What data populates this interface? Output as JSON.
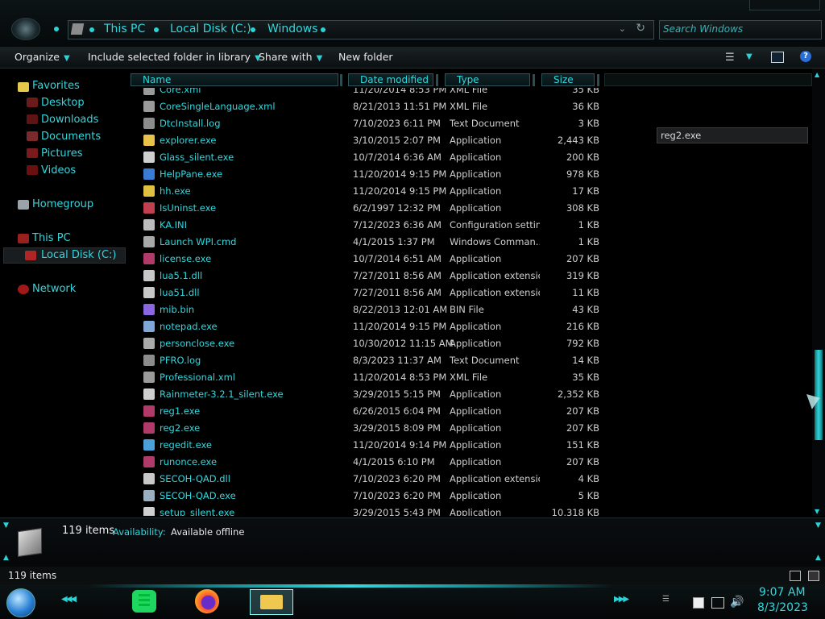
{
  "address": {
    "crumbs": [
      "This PC",
      "Local Disk (C:)",
      "Windows"
    ]
  },
  "search": {
    "placeholder": "Search Windows"
  },
  "toolbar": {
    "organize": "Organize",
    "include": "Include selected folder in library",
    "share": "Share with",
    "new_folder": "New folder",
    "help": "?"
  },
  "nav": {
    "favorites": "Favorites",
    "desktop": "Desktop",
    "downloads": "Downloads",
    "documents": "Documents",
    "pictures": "Pictures",
    "videos": "Videos",
    "homegroup": "Homegroup",
    "this_pc": "This PC",
    "local_disk": "Local Disk (C:)",
    "network": "Network"
  },
  "columns": {
    "name": "Name",
    "date": "Date modified",
    "type": "Type",
    "size": "Size"
  },
  "files": [
    {
      "name": "Core.xml",
      "date": "11/20/2014 8:53 PM",
      "type": "XML File",
      "size": "35 KB",
      "icon": "xml-icon"
    },
    {
      "name": "CoreSingleLanguage.xml",
      "date": "8/21/2013 11:51 PM",
      "type": "XML File",
      "size": "36 KB",
      "icon": "xml-icon"
    },
    {
      "name": "DtcInstall.log",
      "date": "7/10/2023 6:11 PM",
      "type": "Text Document",
      "size": "3 KB",
      "icon": "log-icon"
    },
    {
      "name": "explorer.exe",
      "date": "3/10/2015 2:07 PM",
      "type": "Application",
      "size": "2,443 KB",
      "icon": "folder-icon"
    },
    {
      "name": "Glass_silent.exe",
      "date": "10/7/2014 6:36 AM",
      "type": "Application",
      "size": "200 KB",
      "icon": "installer-icon"
    },
    {
      "name": "HelpPane.exe",
      "date": "11/20/2014 9:15 PM",
      "type": "Application",
      "size": "978 KB",
      "icon": "help-icon"
    },
    {
      "name": "hh.exe",
      "date": "11/20/2014 9:15 PM",
      "type": "Application",
      "size": "17 KB",
      "icon": "helpfile-icon"
    },
    {
      "name": "IsUninst.exe",
      "date": "6/2/1997 12:32 PM",
      "type": "Application",
      "size": "308 KB",
      "icon": "uninstall-icon"
    },
    {
      "name": "KA.INI",
      "date": "7/12/2023 6:36 AM",
      "type": "Configuration settin...",
      "size": "1 KB",
      "icon": "ini-icon"
    },
    {
      "name": "Launch WPI.cmd",
      "date": "4/1/2015 1:37 PM",
      "type": "Windows Comman...",
      "size": "1 KB",
      "icon": "cmd-icon"
    },
    {
      "name": "license.exe",
      "date": "10/7/2014 6:51 AM",
      "type": "Application",
      "size": "207 KB",
      "icon": "winrar-icon"
    },
    {
      "name": "lua5.1.dll",
      "date": "7/27/2011 8:56 AM",
      "type": "Application extension",
      "size": "319 KB",
      "icon": "dll-icon"
    },
    {
      "name": "lua51.dll",
      "date": "7/27/2011 8:56 AM",
      "type": "Application extension",
      "size": "11 KB",
      "icon": "dll-icon"
    },
    {
      "name": "mib.bin",
      "date": "8/22/2013 12:01 AM",
      "type": "BIN File",
      "size": "43 KB",
      "icon": "bin-icon"
    },
    {
      "name": "notepad.exe",
      "date": "11/20/2014 9:15 PM",
      "type": "Application",
      "size": "216 KB",
      "icon": "notepad-icon"
    },
    {
      "name": "personclose.exe",
      "date": "10/30/2012 11:15 AM",
      "type": "Application",
      "size": "792 KB",
      "icon": "arrow-up-icon"
    },
    {
      "name": "PFRO.log",
      "date": "8/3/2023 11:37 AM",
      "type": "Text Document",
      "size": "14 KB",
      "icon": "log-icon"
    },
    {
      "name": "Professional.xml",
      "date": "11/20/2014 8:53 PM",
      "type": "XML File",
      "size": "35 KB",
      "icon": "xml-icon"
    },
    {
      "name": "Rainmeter-3.2.1_silent.exe",
      "date": "3/29/2015 5:15 PM",
      "type": "Application",
      "size": "2,352 KB",
      "icon": "installer-icon"
    },
    {
      "name": "reg1.exe",
      "date": "6/26/2015 6:04 PM",
      "type": "Application",
      "size": "207 KB",
      "icon": "winrar-icon"
    },
    {
      "name": "reg2.exe",
      "date": "3/29/2015 8:09 PM",
      "type": "Application",
      "size": "207 KB",
      "icon": "winrar-icon"
    },
    {
      "name": "regedit.exe",
      "date": "11/20/2014 9:14 PM",
      "type": "Application",
      "size": "151 KB",
      "icon": "regedit-icon"
    },
    {
      "name": "runonce.exe",
      "date": "4/1/2015 6:10 PM",
      "type": "Application",
      "size": "207 KB",
      "icon": "winrar-icon"
    },
    {
      "name": "SECOH-QAD.dll",
      "date": "7/10/2023 6:20 PM",
      "type": "Application extension",
      "size": "4 KB",
      "icon": "dll-icon"
    },
    {
      "name": "SECOH-QAD.exe",
      "date": "7/10/2023 6:20 PM",
      "type": "Application",
      "size": "5 KB",
      "icon": "window-icon"
    },
    {
      "name": "setup_silent.exe",
      "date": "3/29/2015 5:43 PM",
      "type": "Application",
      "size": "10,318 KB",
      "icon": "installer-icon"
    }
  ],
  "tooltip": "reg2.exe",
  "details": {
    "count": "119 items",
    "availability_label": "Availability:",
    "availability_value": "Available offline"
  },
  "status": {
    "count": "119 items"
  },
  "clock": {
    "time": "9:07 AM",
    "date": "8/3/2023"
  },
  "colors": {
    "accent": "#2fd8de",
    "background": "#000000",
    "text": "#cfcfcf"
  }
}
